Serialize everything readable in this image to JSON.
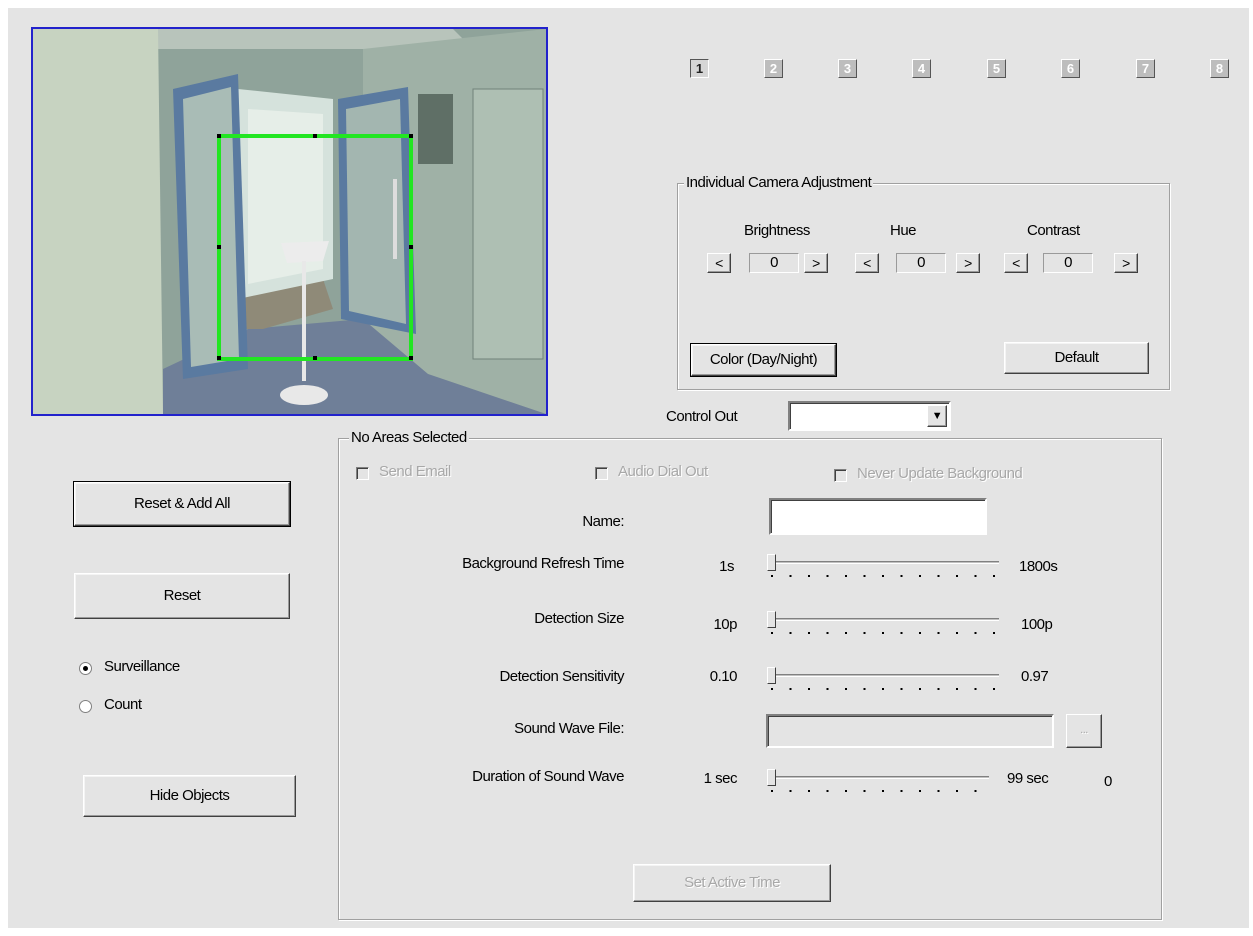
{
  "cameras": [
    "1",
    "2",
    "3",
    "4",
    "5",
    "6",
    "7",
    "8"
  ],
  "active_camera": "1",
  "adjustment": {
    "title": "Individual Camera Adjustment",
    "brightness_label": "Brightness",
    "hue_label": "Hue",
    "contrast_label": "Contrast",
    "brightness_value": "0",
    "hue_value": "0",
    "contrast_value": "0",
    "dec_label": "<",
    "inc_label": ">",
    "color_button": "Color (Day/Night)",
    "default_button": "Default"
  },
  "control_out": {
    "label": "Control Out",
    "value": "",
    "arrow": "▼"
  },
  "left": {
    "reset_add_all": "Reset & Add All",
    "reset": "Reset",
    "mode_surveillance": "Surveillance",
    "mode_count": "Count",
    "selected_mode": "Surveillance",
    "hide_objects": "Hide Objects"
  },
  "area": {
    "title": "No Areas Selected",
    "send_email": "Send Email",
    "audio_dial_out": "Audio Dial Out",
    "never_update_background": "Never Update Background",
    "name_label": "Name:",
    "name_value": "",
    "refresh": {
      "label": "Background Refresh Time",
      "min": "1s",
      "max": "1800s",
      "value_fraction": 0.0
    },
    "size": {
      "label": "Detection Size",
      "min": "10p",
      "max": "100p",
      "value_fraction": 0.0
    },
    "sensitivity": {
      "label": "Detection Sensitivity",
      "min": "0.10",
      "max": "0.97",
      "value_fraction": 0.0
    },
    "sound_file_label": "Sound Wave File:",
    "sound_file_value": "",
    "browse_label": "...",
    "duration": {
      "label": "Duration of Sound Wave",
      "min": "1 sec",
      "max": "99 sec",
      "current": "0",
      "value_fraction": 0.0
    },
    "set_active_time": "Set Active Time"
  },
  "colors": {
    "detection_box": "#22e622",
    "preview_border": "#2222cc",
    "window_bg": "#e4e4e4"
  }
}
